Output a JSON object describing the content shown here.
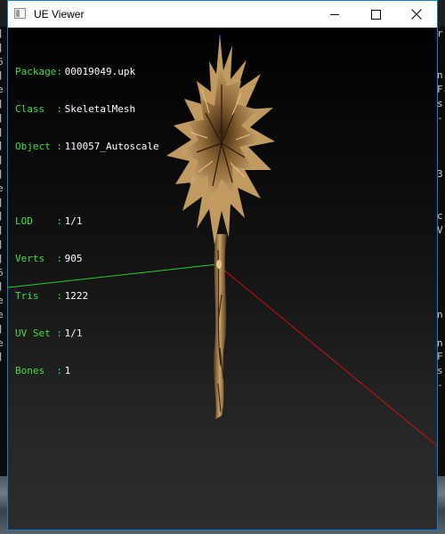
{
  "window": {
    "title": "UE Viewer"
  },
  "info": {
    "package": {
      "label": "Package:",
      "value": "00019049.upk"
    },
    "class": {
      "label": "Class  :",
      "value": "SkeletalMesh"
    },
    "object": {
      "label": "Object :",
      "value": "110057_Autoscale"
    },
    "lod": {
      "label": "LOD    :",
      "value": "1/1"
    },
    "verts": {
      "label": "Verts  :",
      "value": "905"
    },
    "tris": {
      "label": "Tris   :",
      "value": "1222"
    },
    "uvset": {
      "label": "UV Set :",
      "value": "1/1"
    },
    "bones": {
      "label": "Bones  :",
      "value": "1"
    }
  },
  "colors": {
    "info_label": "#3ee03e",
    "axis_x": "#d01010",
    "axis_y": "#22d422",
    "axis_z": "#2020d0",
    "mesh": "#b08a55"
  },
  "background_console": {
    "left_glyphs": [
      "]",
      "]",
      "6",
      "]",
      "e",
      "]",
      "]",
      "]",
      "]",
      "]",
      "]",
      "e",
      "]",
      "]",
      "]",
      "]",
      "]",
      "6",
      "]",
      "e",
      "e",
      "]",
      "e",
      "]"
    ],
    "right_glyphs": [
      "r",
      "",
      "",
      "n",
      "F",
      "s",
      "-",
      "",
      "",
      "",
      "3",
      "",
      "",
      "c",
      "V",
      "",
      "",
      "",
      "",
      "",
      "n",
      "",
      "n",
      "F",
      "s",
      "-"
    ]
  }
}
